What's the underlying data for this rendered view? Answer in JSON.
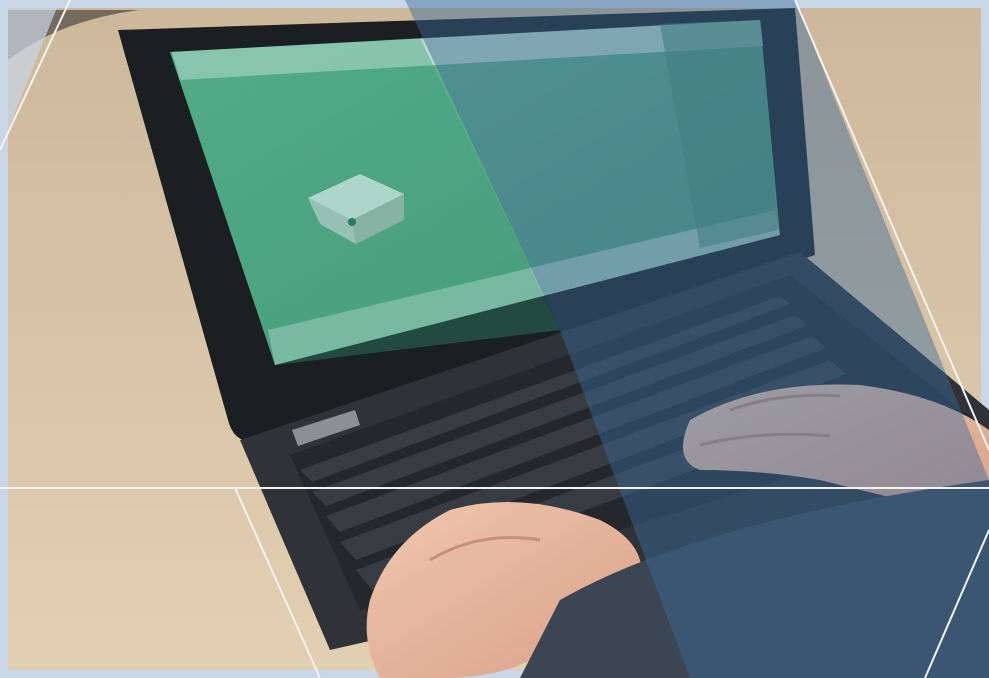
{
  "photo": {
    "subject": "hands-typing-on-laptop",
    "colors": {
      "frame": "#c9d6e6",
      "table": "#d8c3a5",
      "laptop_body": "#2f3338",
      "keyboard": "#24282d",
      "key": "#3a3f45",
      "screen_bezel": "#1c1f22",
      "screen_app": "#5fae8a",
      "overlay_blue": "#3a6a9a",
      "overlay_green": "#2f9c7a",
      "hand": "#e6b59e",
      "sleeve": "#3c4652",
      "line": "#f2f2f2"
    }
  },
  "screen": {
    "app": "3d-modeling-app",
    "object": "cube"
  }
}
